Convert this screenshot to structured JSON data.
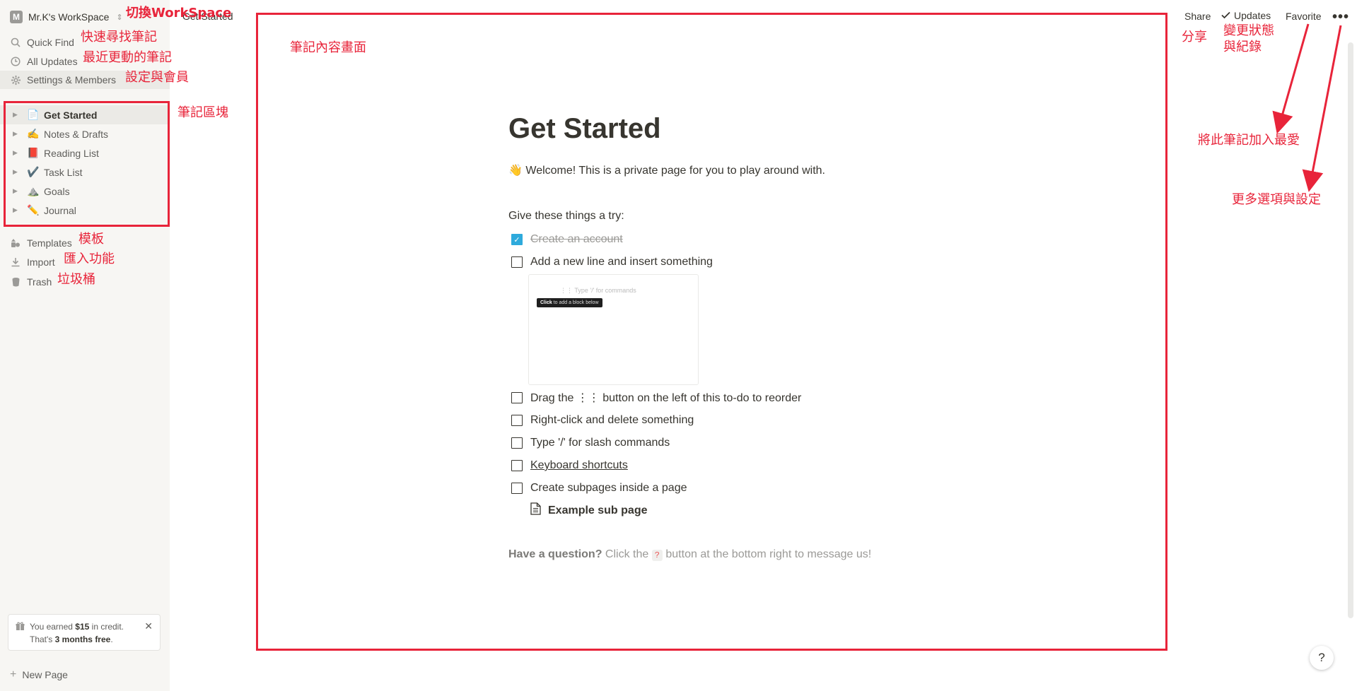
{
  "sidebar": {
    "workspace": {
      "logo": "M",
      "name": "Mr.K's WorkSpace",
      "chevron": "⇕",
      "ghost_label": "Get Started"
    },
    "nav": [
      {
        "label": "Quick Find",
        "icon": "search-icon"
      },
      {
        "label": "All Updates",
        "icon": "clock-icon"
      },
      {
        "label": "Settings & Members",
        "icon": "gear-icon"
      }
    ],
    "pages": [
      {
        "label": "Get Started",
        "emoji": "📄"
      },
      {
        "label": "Notes & Drafts",
        "emoji": "✍️"
      },
      {
        "label": "Reading List",
        "emoji": "📕"
      },
      {
        "label": "Task List",
        "emoji": "✔️"
      },
      {
        "label": "Goals",
        "emoji": "⛰️"
      },
      {
        "label": "Journal",
        "emoji": "✏️"
      }
    ],
    "tools": [
      {
        "label": "Templates",
        "icon": "templates-icon"
      },
      {
        "label": "Import",
        "icon": "download-icon"
      },
      {
        "label": "Trash",
        "icon": "trash-icon"
      }
    ],
    "credit": {
      "pre": "You earned ",
      "amount": "$15",
      "mid": " in credit.",
      "line2_pre": "That's ",
      "months": "3 months free",
      "line2_post": "."
    },
    "new_page": "New Page"
  },
  "topbar": {
    "share": "Share",
    "updates": "Updates",
    "favorite": "Favorite",
    "more": "•••"
  },
  "page": {
    "title": "Get Started",
    "welcome_emoji": "👋",
    "welcome": "Welcome! This is a private page for you to play around with.",
    "try_label": "Give these things a try:",
    "todos": [
      {
        "label": "Create an account",
        "checked": true
      },
      {
        "label": "Add a new line and insert something",
        "checked": false
      },
      {
        "label": "Drag the ⋮⋮ button on the left of this to-do to reorder",
        "checked": false
      },
      {
        "label": "Right-click and delete something",
        "checked": false
      },
      {
        "label": "Type '/' for slash commands",
        "checked": false
      },
      {
        "label": "Keyboard shortcuts",
        "checked": false
      },
      {
        "label": "Create subpages inside a page",
        "checked": false
      }
    ],
    "demo": {
      "hint": "⋮⋮ Type '/' for commands",
      "tip_bold": "Click",
      "tip_rest": " to add a block below"
    },
    "sub_page": "Example sub page",
    "question_bold": "Have a question?",
    "question_pre": " Click the ",
    "question_key": "?",
    "question_post": " button at the bottom right to message us!"
  },
  "help_button": "?",
  "annotations": {
    "switch_workspace": "切換WorkSpace",
    "quick_find": "快速尋找筆記",
    "recent": "最近更動的筆記",
    "settings": "設定與會員",
    "block_area": "筆記區塊",
    "templates": "模板",
    "import": "匯入功能",
    "trash": "垃圾桶",
    "content": "筆記內容畫面",
    "share": "分享",
    "updates_1": "變更狀態",
    "updates_2": "與紀錄",
    "favorite": "將此筆記加入最愛",
    "more": "更多選項與設定"
  },
  "colors": {
    "annotation": "#e8243a",
    "sidebar_bg": "#f7f6f3",
    "checkbox_checked": "#2eaadc"
  }
}
